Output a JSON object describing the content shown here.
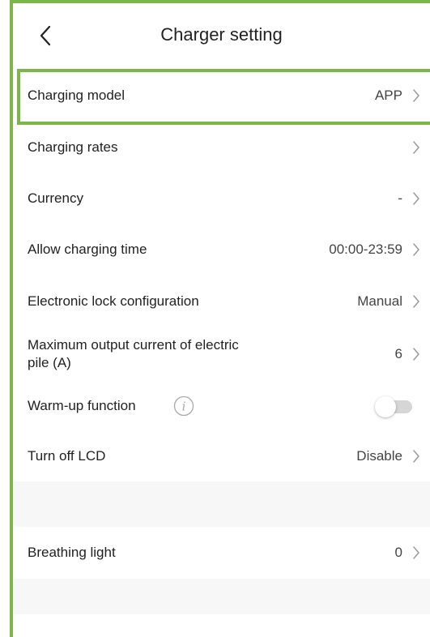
{
  "colors": {
    "highlight": "#7ab648",
    "frame": "#7ab648",
    "chevron": "#9a9a9a"
  },
  "header": {
    "title": "Charger setting",
    "back_icon": "chevron-left-icon"
  },
  "rows": [
    {
      "label": "Charging model",
      "value": "APP"
    },
    {
      "label": "Charging rates",
      "value": ""
    },
    {
      "label": "Currency",
      "value": "-"
    },
    {
      "label": "Allow charging time",
      "value": "00:00-23:59"
    },
    {
      "label": "Electronic lock configuration",
      "value": "Manual"
    },
    {
      "label": "Maximum output current of electric pile (A)",
      "value": "6"
    },
    {
      "label": "Warm-up function",
      "toggle_on": false,
      "info_icon": "info-icon"
    },
    {
      "label": "Turn off LCD",
      "value": "Disable"
    },
    {
      "label": "Breathing light",
      "value": "0"
    }
  ]
}
